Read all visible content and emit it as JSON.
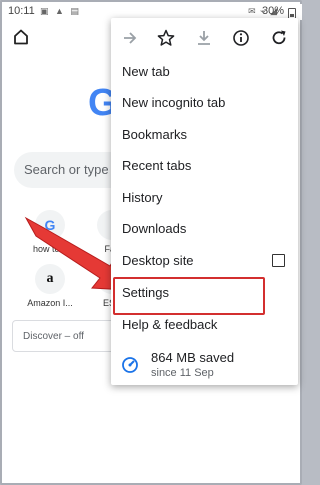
{
  "status_bar": {
    "time": "10:11",
    "battery": "30%"
  },
  "background_page": {
    "search_placeholder": "Search or type w",
    "tiles": [
      {
        "letter": "G",
        "label": "how to p"
      },
      {
        "letter": "",
        "label": "Fac"
      },
      {
        "letter": "a",
        "label": "Amazon I..."
      },
      {
        "letter": "",
        "label": "ESP"
      }
    ],
    "discover": "Discover – off"
  },
  "menu": {
    "toolbar_icons": [
      "forward-icon",
      "star-icon",
      "download-icon",
      "info-icon",
      "refresh-icon"
    ],
    "items": [
      {
        "label": "New tab"
      },
      {
        "label": "New incognito tab"
      },
      {
        "label": "Bookmarks"
      },
      {
        "label": "Recent tabs"
      },
      {
        "label": "History"
      },
      {
        "label": "Downloads"
      },
      {
        "label": "Desktop site"
      },
      {
        "label": "Settings"
      },
      {
        "label": "Help & feedback"
      }
    ],
    "data_saved": {
      "amount": "864 MB saved",
      "since": "since 11 Sep"
    }
  },
  "colors": {
    "highlight": "#d32f2f",
    "arrow": "#e53935",
    "accent": "#1a73e8"
  }
}
